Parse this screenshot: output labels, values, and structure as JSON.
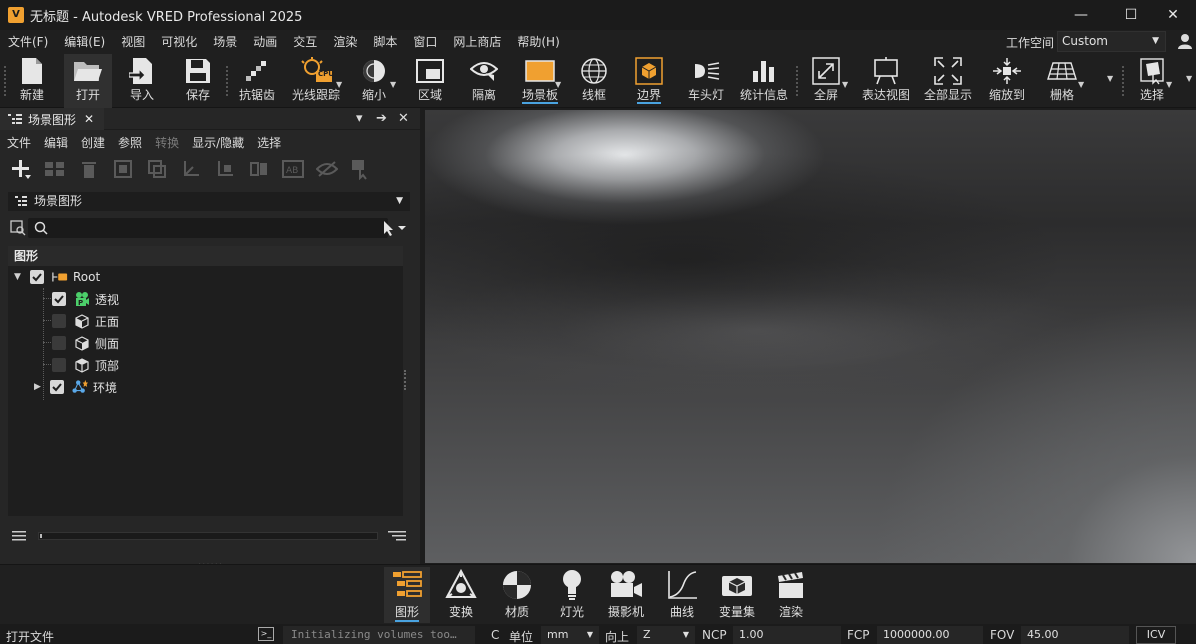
{
  "window": {
    "logo": "V",
    "title": "无标题 - Autodesk VRED Professional 2025",
    "minimize": "—",
    "maximize": "☐",
    "close": "✕"
  },
  "menubar": {
    "items": [
      "文件(F)",
      "编辑(E)",
      "视图",
      "可视化",
      "场景",
      "动画",
      "交互",
      "渲染",
      "脚本",
      "窗口",
      "网上商店",
      "帮助(H)"
    ],
    "workspace_label": "工作空间",
    "workspace_value": "Custom"
  },
  "toolbar": {
    "new": "新建",
    "open": "打开",
    "import": "导入",
    "save": "保存",
    "antialias": "抗锯齿",
    "raytrace": "光线跟踪",
    "raytrace_badge": "CPU",
    "shrink": "缩小",
    "region": "区域",
    "isolate": "隔离",
    "sceneplate": "场景板",
    "wireframe": "线框",
    "bounds": "边界",
    "headlight": "车头灯",
    "stats": "统计信息",
    "fullscreen": "全屏",
    "presentation": "表达视图",
    "showall": "全部显示",
    "zoomto": "缩放到",
    "grid": "栅格",
    "select": "选择"
  },
  "panel": {
    "tab_title": "场景图形",
    "close": "✕",
    "menu": [
      "文件",
      "编辑",
      "创建",
      "参照",
      "转换",
      "显示/隐藏",
      "选择"
    ],
    "graph_select": "场景图形",
    "search_placeholder": "",
    "tree_header": "图形",
    "tree": [
      {
        "label": "Root",
        "checked": true
      },
      {
        "label": "透视",
        "checked": true
      },
      {
        "label": "正面",
        "checked": false
      },
      {
        "label": "侧面",
        "checked": false
      },
      {
        "label": "顶部",
        "checked": false
      },
      {
        "label": "环境",
        "checked": true
      }
    ],
    "splitter": "......"
  },
  "dock": {
    "items": [
      "图形",
      "变换",
      "材质",
      "灯光",
      "摄影机",
      "曲线",
      "变量集",
      "渲染"
    ]
  },
  "statusbar": {
    "message": "打开文件",
    "console": ">_",
    "log": "Initializing volumes too…",
    "c_label": "C",
    "unit_label": "单位",
    "unit_value": "mm",
    "up_label": "向上",
    "up_value": "Z",
    "ncp_label": "NCP",
    "ncp_value": "1.00",
    "fcp_label": "FCP",
    "fcp_value": "1000000.00",
    "fov_label": "FOV",
    "fov_value": "45.00",
    "icv": "ICV"
  },
  "colors": {
    "accent": "#4aa3e0",
    "brand_orange": "#f0a030",
    "background": "#1f1f1f"
  }
}
